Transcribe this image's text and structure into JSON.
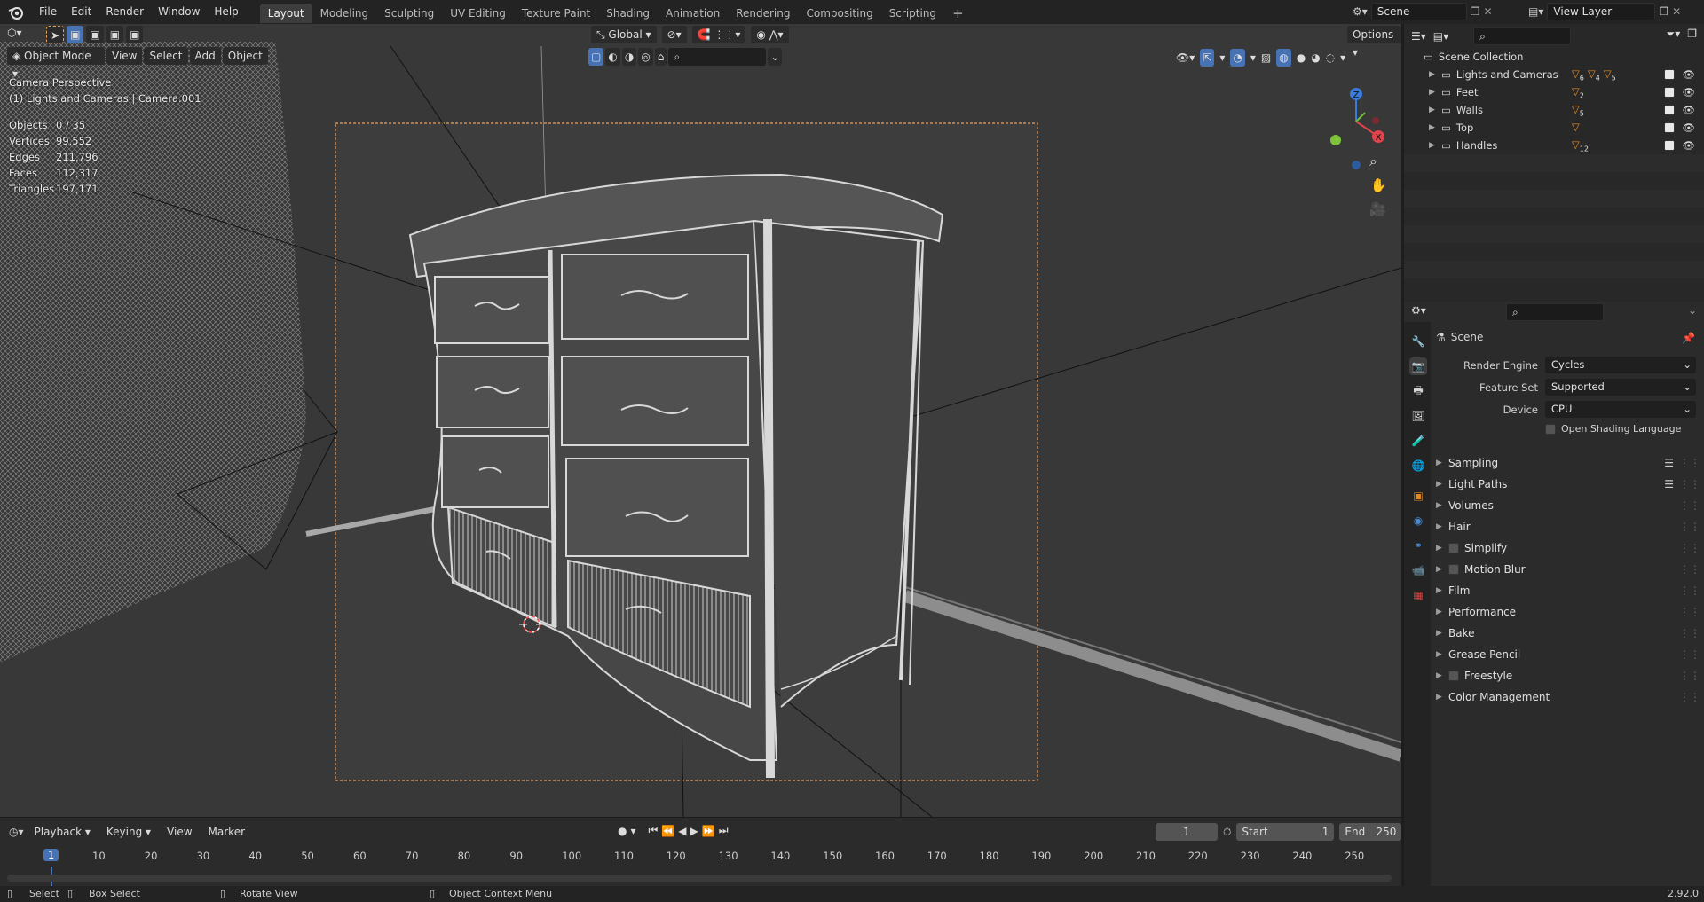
{
  "topbar": {
    "menus": [
      "File",
      "Edit",
      "Render",
      "Window",
      "Help"
    ],
    "workspaces": [
      "Layout",
      "Modeling",
      "Sculpting",
      "UV Editing",
      "Texture Paint",
      "Shading",
      "Animation",
      "Rendering",
      "Compositing",
      "Scripting"
    ],
    "active_workspace": "Layout",
    "add_tab": "+",
    "scene_name": "Scene",
    "view_layer": "View Layer"
  },
  "viewport": {
    "mode": "Object Mode",
    "menus": [
      "View",
      "Select",
      "Add",
      "Object"
    ],
    "orientation": "Global",
    "options_label": "Options",
    "overlay_title": "Camera Perspective",
    "overlay_subtitle": "(1) Lights and Cameras | Camera.001",
    "stats": [
      {
        "label": "Objects",
        "value": "0 / 35"
      },
      {
        "label": "Vertices",
        "value": "99,552"
      },
      {
        "label": "Edges",
        "value": "211,796"
      },
      {
        "label": "Faces",
        "value": "112,317"
      },
      {
        "label": "Triangles",
        "value": "197,171"
      }
    ],
    "gizmo": {
      "z": "Z",
      "y": "Y",
      "x": "X"
    }
  },
  "timeline": {
    "menus": [
      "Playback",
      "Keying",
      "View",
      "Marker"
    ],
    "current_frame": "1",
    "start_label": "Start",
    "start_value": "1",
    "end_label": "End",
    "end_value": "250",
    "ruler": [
      "10",
      "20",
      "30",
      "40",
      "50",
      "60",
      "70",
      "80",
      "90",
      "100",
      "110",
      "120",
      "130",
      "140",
      "150",
      "160",
      "170",
      "180",
      "190",
      "200",
      "210",
      "220",
      "230",
      "240",
      "250"
    ],
    "playhead": "1"
  },
  "statusbar": {
    "items": [
      "Select",
      "Box Select",
      "Rotate View",
      "Object Context Menu"
    ],
    "version": "2.92.0"
  },
  "outliner": {
    "root": "Scene Collection",
    "collections": [
      {
        "name": "Lights and Cameras",
        "badges": [
          "6",
          "4",
          "5"
        ]
      },
      {
        "name": "Feet",
        "badges": [
          "2"
        ]
      },
      {
        "name": "Walls",
        "badges": [
          "5"
        ]
      },
      {
        "name": "Top",
        "badges": [
          ""
        ]
      },
      {
        "name": "Handles",
        "badges": [
          "12"
        ]
      }
    ]
  },
  "properties": {
    "context": "Scene",
    "render_engine_label": "Render Engine",
    "render_engine": "Cycles",
    "feature_set_label": "Feature Set",
    "feature_set": "Supported",
    "device_label": "Device",
    "device": "CPU",
    "osl_label": "Open Shading Language",
    "panels": [
      {
        "name": "Sampling",
        "checkbox": false,
        "list": true
      },
      {
        "name": "Light Paths",
        "checkbox": false,
        "list": true
      },
      {
        "name": "Volumes",
        "checkbox": false,
        "list": false
      },
      {
        "name": "Hair",
        "checkbox": false,
        "list": false
      },
      {
        "name": "Simplify",
        "checkbox": true,
        "list": false
      },
      {
        "name": "Motion Blur",
        "checkbox": true,
        "list": false
      },
      {
        "name": "Film",
        "checkbox": false,
        "list": false
      },
      {
        "name": "Performance",
        "checkbox": false,
        "list": false
      },
      {
        "name": "Bake",
        "checkbox": false,
        "list": false
      },
      {
        "name": "Grease Pencil",
        "checkbox": false,
        "list": false
      },
      {
        "name": "Freestyle",
        "checkbox": true,
        "list": false
      },
      {
        "name": "Color Management",
        "checkbox": false,
        "list": false
      }
    ]
  },
  "colors": {
    "accent": "#4772b3",
    "viewport_bg": "#3a3a3a",
    "camera_frame": "#e8a060",
    "object_orange": "#e08a2a"
  }
}
